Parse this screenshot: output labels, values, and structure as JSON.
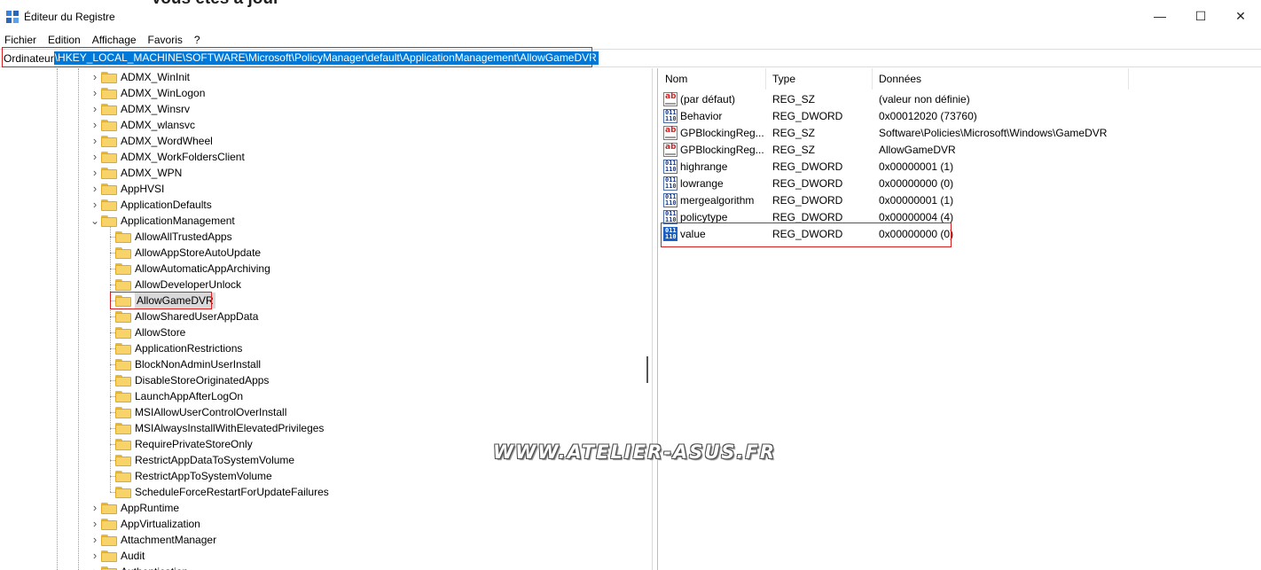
{
  "window": {
    "title": "Éditeur du Registre",
    "background_peek_text": "Vous êtes à jour",
    "controls": {
      "minimize": "—",
      "maximize": "☐",
      "close": "✕"
    },
    "icon": "registry-editor-icon"
  },
  "menu": [
    "Fichier",
    "Edition",
    "Affichage",
    "Favoris",
    "?"
  ],
  "address": {
    "root": "Ordinateur",
    "path": "\\HKEY_LOCAL_MACHINE\\SOFTWARE\\Microsoft\\PolicyManager\\default\\ApplicationManagement\\AllowGameDVR"
  },
  "tree": {
    "siblings_above": [
      "ADMX_WinInit",
      "ADMX_WinLogon",
      "ADMX_Winsrv",
      "ADMX_wlansvc",
      "ADMX_WordWheel",
      "ADMX_WorkFoldersClient",
      "ADMX_WPN",
      "AppHVSI",
      "ApplicationDefaults"
    ],
    "expanded": "ApplicationManagement",
    "children": [
      "AllowAllTrustedApps",
      "AllowAppStoreAutoUpdate",
      "AllowAutomaticAppArchiving",
      "AllowDeveloperUnlock",
      "AllowGameDVR",
      "AllowSharedUserAppData",
      "AllowStore",
      "ApplicationRestrictions",
      "BlockNonAdminUserInstall",
      "DisableStoreOriginatedApps",
      "LaunchAppAfterLogOn",
      "MSIAllowUserControlOverInstall",
      "MSIAlwaysInstallWithElevatedPrivileges",
      "RequirePrivateStoreOnly",
      "RestrictAppDataToSystemVolume",
      "RestrictAppToSystemVolume",
      "ScheduleForceRestartForUpdateFailures"
    ],
    "selected_child": "AllowGameDVR",
    "siblings_below": [
      "AppRuntime",
      "AppVirtualization",
      "AttachmentManager",
      "Audit",
      "Authentication"
    ]
  },
  "list": {
    "columns": {
      "name": "Nom",
      "type": "Type",
      "data": "Données"
    },
    "rows": [
      {
        "name": "(par défaut)",
        "type": "REG_SZ",
        "data": "(valeur non définie)",
        "icon": "string-value-icon"
      },
      {
        "name": "Behavior",
        "type": "REG_DWORD",
        "data": "0x00012020 (73760)",
        "icon": "dword-value-icon"
      },
      {
        "name": "GPBlockingReg...",
        "type": "REG_SZ",
        "data": "Software\\Policies\\Microsoft\\Windows\\GameDVR",
        "icon": "string-value-icon"
      },
      {
        "name": "GPBlockingReg...",
        "type": "REG_SZ",
        "data": "AllowGameDVR",
        "icon": "string-value-icon"
      },
      {
        "name": "highrange",
        "type": "REG_DWORD",
        "data": "0x00000001 (1)",
        "icon": "dword-value-icon"
      },
      {
        "name": "lowrange",
        "type": "REG_DWORD",
        "data": "0x00000000 (0)",
        "icon": "dword-value-icon"
      },
      {
        "name": "mergealgorithm",
        "type": "REG_DWORD",
        "data": "0x00000001 (1)",
        "icon": "dword-value-icon"
      },
      {
        "name": "policytype",
        "type": "REG_DWORD",
        "data": "0x00000004 (4)",
        "icon": "dword-value-icon"
      },
      {
        "name": "value",
        "type": "REG_DWORD",
        "data": "0x00000000 (0)",
        "icon": "dword-value-icon"
      }
    ],
    "selected_row": "value"
  },
  "watermark": "WWW.ATELIER-ASUS.FR",
  "colors": {
    "highlight_box": "#d81f1f",
    "address_selection": "#0078d7",
    "folder": "#f8d36a"
  }
}
